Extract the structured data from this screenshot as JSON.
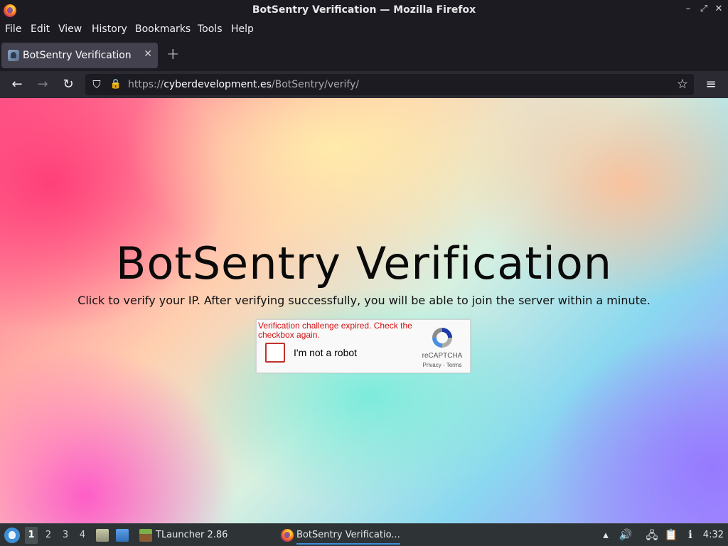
{
  "window": {
    "title": "BotSentry Verification — Mozilla Firefox",
    "icon": "firefox-icon",
    "controls": {
      "minimize": "–",
      "maximize": "⤢",
      "close": "✕"
    }
  },
  "menu": [
    "File",
    "Edit",
    "View",
    "History",
    "Bookmarks",
    "Tools",
    "Help"
  ],
  "tabs": [
    {
      "label": "BotSentry Verification",
      "icon": "botsentry-favicon",
      "active": true
    }
  ],
  "newtab_label": "+",
  "nav": {
    "back": "←",
    "forward": "→",
    "reload": "↻",
    "url_prefix": "https://",
    "url_domain": "cyberdevelopment.es",
    "url_path": "/BotSentry/verify/",
    "shield": "⛉",
    "lock": "🔒",
    "bookmark": "☆",
    "menu": "≡"
  },
  "page": {
    "headline": "BotSentry Verification",
    "subline": "Click to verify your IP. After verifying successfully, you will be able to join the server within a minute.",
    "captcha": {
      "error": "Verification challenge expired. Check the checkbox again.",
      "checkbox_label": "I'm not a robot",
      "brand": "reCAPTCHA",
      "links": "Privacy - Terms",
      "checked": false
    }
  },
  "taskbar": {
    "workspaces": [
      "1",
      "2",
      "3",
      "4"
    ],
    "active_workspace": "1",
    "tasks": [
      {
        "label": "TLauncher 2.86",
        "icon": "minecraft-block-icon"
      },
      {
        "label": "BotSentry Verificatio...",
        "icon": "firefox-icon",
        "active": true
      }
    ],
    "clock": "4:32"
  }
}
